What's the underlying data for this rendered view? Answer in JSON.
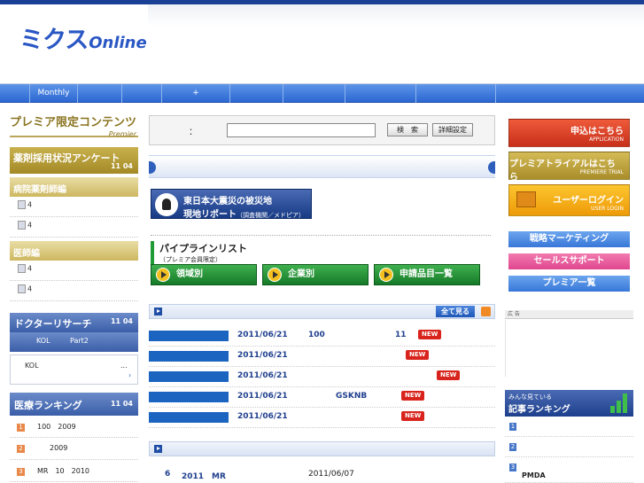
{
  "header": {
    "logo_mark": "ミクス",
    "logo_sub": "Online"
  },
  "nav": {
    "items": [
      "",
      "Monthly",
      "",
      "",
      "+",
      "",
      "",
      "",
      ""
    ]
  },
  "left": {
    "premier_title": "プレミア限定コンテンツ",
    "premier_sub": "Premier",
    "survey": {
      "title": "薬剤採用状況アンケート",
      "date": "11 04",
      "hospital_label": "病院薬剤師編",
      "hospital_items": [
        "4",
        "4"
      ],
      "doctor_label": "医師編",
      "doctor_items": [
        "4",
        "4"
      ]
    },
    "doctor_research": {
      "title": "ドクターリサーチ",
      "date": "11 04",
      "line1_a": "KOL",
      "line1_b": "Part2",
      "line2_a": "KOL",
      "line2_b": "...",
      "more": "›"
    },
    "medical_ranking": {
      "title": "医療ランキング",
      "date": "11 04",
      "items": [
        {
          "rank": "1",
          "text": "100　2009"
        },
        {
          "rank": "2",
          "text": "2009"
        },
        {
          "rank": "3",
          "text": "MR　10　2010"
        }
      ]
    }
  },
  "search": {
    "colon": "：",
    "input_value": "",
    "search_button": "検　索",
    "advanced_button": "詳細設定"
  },
  "quake": {
    "line1": "東日本大震災の被災地",
    "line2": "現地リポート",
    "line2_note": "（調査機関／メドピア）"
  },
  "pipeline": {
    "title": "パイプラインリスト",
    "subtitle": "（プレミア会員限定）",
    "buttons": [
      "領域別",
      "企業別",
      "申請品目一覧"
    ]
  },
  "news": {
    "see_all": "全て見る",
    "rows": [
      {
        "date": "2011/06/21",
        "t1": "100",
        "t2": "11",
        "new": "NEW"
      },
      {
        "date": "2011/06/21",
        "t1": "",
        "t2": "",
        "new": "NEW"
      },
      {
        "date": "2011/06/21",
        "t1": "",
        "t2": "",
        "new": "NEW"
      },
      {
        "date": "2011/06/21",
        "t1": "GSKNB",
        "t2": "",
        "new": "NEW"
      },
      {
        "date": "2011/06/21",
        "t1": "",
        "t2": "",
        "new": "NEW"
      }
    ]
  },
  "news2": {
    "num": "6",
    "text": "2011　MR",
    "date": "2011/06/07"
  },
  "right": {
    "apply": {
      "main": "申込はこちら",
      "sub": "APPLICATION"
    },
    "trial": {
      "main": "プレミアトライアルはこちら",
      "sub": "PREMIERE TRIAL"
    },
    "login": {
      "main": "ユーザーログイン",
      "sub": "USER LOGIN"
    },
    "links": [
      "戦略マーケティング",
      "セールスサポート",
      "プレミア一覧"
    ],
    "ad_label": "広 告",
    "ranking": {
      "line1": "みんな見ている",
      "line2": "記事ランキング",
      "items": [
        {
          "rank": "1",
          "text": ""
        },
        {
          "rank": "2",
          "text": ""
        },
        {
          "rank": "3",
          "text": "PMDA"
        }
      ]
    }
  },
  "colors": {
    "brand_blue": "#2a57c4",
    "nav_blue": "#2c67d2",
    "gold": "#a38a26",
    "green": "#167a28",
    "new_red": "#d8241c",
    "link_blue": "#1f3f8e"
  }
}
